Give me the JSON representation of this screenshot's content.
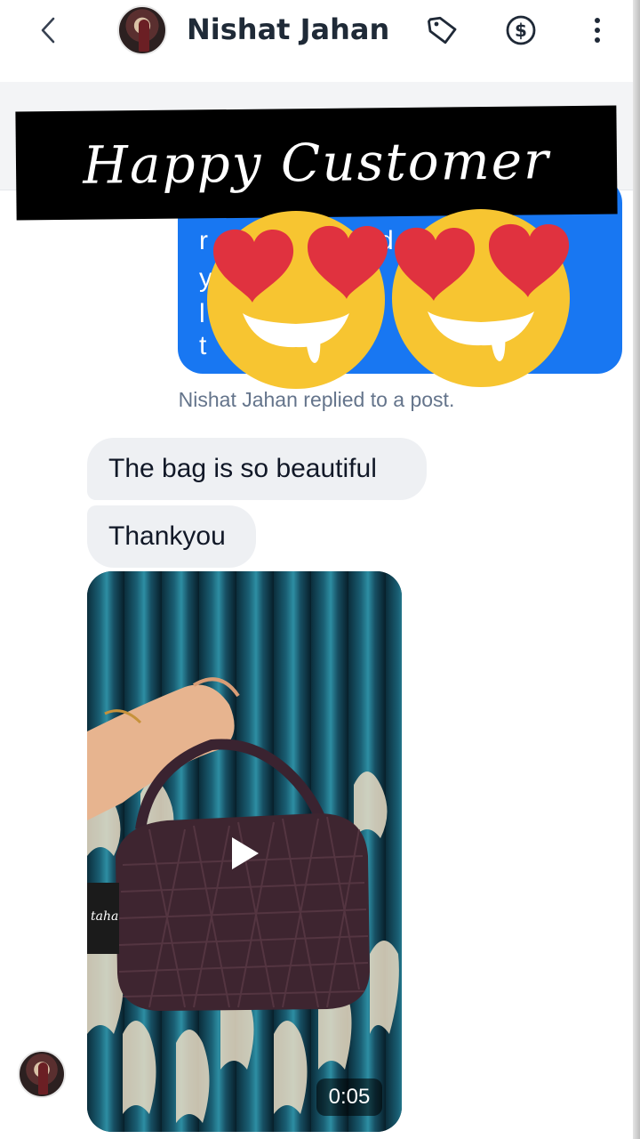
{
  "header": {
    "contact_name": "Nishat Jahan",
    "icons": [
      "back-chevron-icon",
      "tag-icon",
      "dollar-icon",
      "more-vertical-icon"
    ]
  },
  "banner": {
    "text": "Happy Customer"
  },
  "blue_bubble": {
    "fragments": [
      "r",
      "d",
      "y",
      "l",
      "t"
    ]
  },
  "reply_note": "Nishat Jahan replied to a post.",
  "messages": [
    {
      "text": "The bag is so beautiful"
    },
    {
      "text": "Thankyou"
    }
  ],
  "video": {
    "duration": "0:05",
    "brand_tag_text": "taha"
  },
  "colors": {
    "messenger_blue": "#1877f2",
    "bubble_gray": "#eef0f3",
    "banner_black": "#000000",
    "emoji_yellow": "#f7c531",
    "heart_red": "#e0323f"
  }
}
